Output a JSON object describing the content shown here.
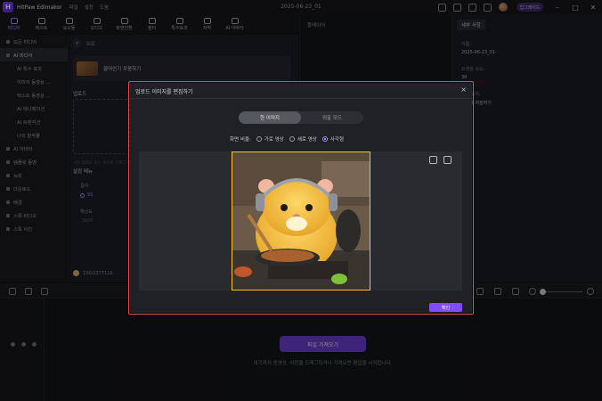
{
  "titlebar": {
    "app_name": "HitPaw Edimakor",
    "menu": [
      "파일",
      "설정",
      "도움"
    ],
    "doc_title": "2025-06-23_01",
    "upgrade_label": "업그레이드"
  },
  "toolbar": {
    "tools": [
      {
        "label": "미디어",
        "icon": "media-icon",
        "active": true
      },
      {
        "label": "텍스트",
        "icon": "text-icon",
        "active": false
      },
      {
        "label": "요소들",
        "icon": "elements-icon",
        "active": false
      },
      {
        "label": "오디오",
        "icon": "audio-icon",
        "active": false
      },
      {
        "label": "화면전환",
        "icon": "transition-icon",
        "active": false
      },
      {
        "label": "필터",
        "icon": "filter-icon",
        "active": false
      },
      {
        "label": "특수효과",
        "icon": "effects-icon",
        "active": false
      },
      {
        "label": "자막",
        "icon": "subtitle-icon",
        "active": false
      },
      {
        "label": "AI 아바타",
        "icon": "ai-avatar-icon",
        "active": false
      }
    ]
  },
  "sidebar": {
    "items": [
      {
        "label": "모든 미디어",
        "type": "main",
        "state": "normal"
      },
      {
        "label": "AI 미디어",
        "type": "main",
        "state": "selected"
      },
      {
        "label": "AI 특수 효과",
        "type": "sub",
        "state": "normal"
      },
      {
        "label": "이미지 동영상 ...",
        "type": "sub",
        "state": "normal"
      },
      {
        "label": "텍스트 동영상 ...",
        "type": "sub",
        "state": "normal"
      },
      {
        "label": "AI 애니메이션",
        "type": "sub",
        "state": "normal"
      },
      {
        "label": "AI 트랜지션",
        "type": "sub",
        "state": "normal"
      },
      {
        "label": "나의 창작물",
        "type": "sub",
        "state": "normal"
      },
      {
        "label": "AI 아바타",
        "type": "main",
        "state": "normal"
      },
      {
        "label": "템플릿 동영",
        "type": "main",
        "state": "normal"
      },
      {
        "label": "녹화",
        "type": "main",
        "state": "normal"
      },
      {
        "label": "다운로드",
        "type": "main",
        "state": "normal"
      },
      {
        "label": "배경",
        "type": "main",
        "state": "normal"
      },
      {
        "label": "스톡 비디오",
        "type": "main",
        "state": "normal"
      },
      {
        "label": "스톡 사진",
        "type": "main",
        "state": "normal"
      }
    ]
  },
  "content": {
    "back_label": "뒤로",
    "card_label": "끌어안기 포옹하기",
    "upload_label": "업로드",
    "upload_hint": "사진 업로드 또는 여기로 드래그 앤 드롭",
    "settings_label": "설정 메뉴",
    "length_label": "길이",
    "length_value": "5S",
    "resolution_label": "해상도",
    "resolution_value": "360P",
    "credits": "150/2377116"
  },
  "player": {
    "title": "플레이어"
  },
  "properties": {
    "tab": "세부 사항",
    "name_label": "이름:",
    "name_value": "2025-06-23_01",
    "fps_label": "프레임 속도:",
    "fps_value": "30",
    "path_label": "저장 위치:",
    "path_value": "로컬에 저장하기"
  },
  "timeline": {
    "import_label": "파일 가져오기",
    "drop_hint": "여기까지 동영상, 사진을 드래그하거나 가져오면 편집을 시작합니다."
  },
  "modal": {
    "title": "업로드 이미지를 편집하기",
    "close": "×",
    "tabs": [
      {
        "label": "한 이미지",
        "active": true
      },
      {
        "label": "외출 모드",
        "active": false
      }
    ],
    "ratio_label": "화면 비율:",
    "ratio_options": [
      {
        "label": "가로 영상",
        "selected": false
      },
      {
        "label": "세로 영상",
        "selected": false
      },
      {
        "label": "사각형",
        "selected": true
      }
    ],
    "confirm_label": "확인"
  },
  "colors": {
    "accent": "#7f4dff",
    "highlight_outline": "#e14b4b",
    "crop_frame": "#f2c230"
  }
}
